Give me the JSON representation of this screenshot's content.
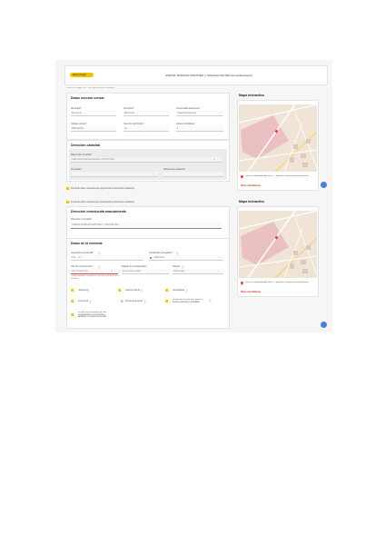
{
  "screen1": {
    "badge": "Datos Origen",
    "address_header": "GRETEL MARIANA MARTINEZ 1, BARCELONA (Barcelona-Barcelona)",
    "hint": "Todos los campos con * son requeridos para continuar",
    "census_title": "Datos sección censal",
    "fields": [
      {
        "label": "Municipio*",
        "value": "Barcelona"
      },
      {
        "label": "Provincia*",
        "value": "Barcelona"
      },
      {
        "label": "Comunidad autónoma*",
        "value": "Cataluña/Catalunya"
      },
      {
        "label": "Código censal*",
        "value": "0801901026"
      },
      {
        "label": "Sección de Distrito*",
        "value": "10"
      },
      {
        "label": "Zona inmobiliaria*",
        "value": "8"
      }
    ],
    "cadastral_title": "Dirección catastral",
    "address_label": "Datos del inmueble*",
    "address_value": "Calle Gretel Mariana Martinez 1 BCN 1 BCN",
    "left_label": "Inmueble*",
    "ref_label": "Referencia catastral*",
    "notice": "Introducir datos manualmente (ignorando la información catastral)",
    "map_title": "Mapa interactivo",
    "map_address": "GRETEL MARIANA MARTINEZ 1, BARCELONA (Barcelona-Barcelona)",
    "map_link": "Datos Inmobiliarios"
  },
  "screen2": {
    "notice": "Introducir datos manualmente (ignorando la información catastral)",
    "manual_title": "Dirección introducida manualmente",
    "manual_label": "Dirección completa*",
    "manual_value": "GRETEL MARIANA MARTINEZ 1, BARCELONA",
    "property_title": "Datos de la vivienda",
    "surface_label": "Superficie construida*",
    "surface_value": "105",
    "surface_unit": "m²",
    "energy_label": "Certificado energético*",
    "energy_value": "Calificación",
    "year_label": "Año de construcción*",
    "year_value": "Año construcción",
    "state_label": "Estado de conservación",
    "state_value": "En perfecto estado",
    "floor_label": "Planta*",
    "floor_value": "Planta baja",
    "error_text": "Campo requerido. Introduzca el año de construcción de la vivienda",
    "toggles": [
      {
        "label": "Ascensor",
        "on": true
      },
      {
        "label": "Aparcamiento",
        "on": true
      },
      {
        "label": "Amueblada",
        "on": true
      },
      {
        "label": "Luminosa",
        "on": true
      },
      {
        "label": "Zonas exteriores",
        "on": false
      },
      {
        "label": "Vivienda con terraza, jardín o zonas exteriores privadas",
        "on": true
      },
      {
        "label": "Zonas comunitarias de uso compartido (como piscina, jardines o zonas comunes)",
        "on": true
      }
    ],
    "map_title": "Mapa interactivo",
    "map_address": "GRETEL MARIANA MARTINEZ 1, BARCELONA (Barcelona-Barcelona)",
    "map_link": "Datos Inmobiliarios"
  },
  "colors": {
    "accent": "#f2c200",
    "error": "#e04040",
    "pin": "#e04040"
  }
}
